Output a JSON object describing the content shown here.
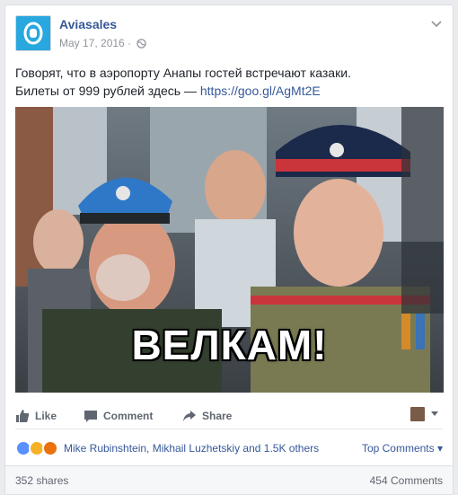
{
  "post": {
    "page_name": "Aviasales",
    "date": "May 17, 2016 ·",
    "text_line1": "Говорят, что в аэропорту Анапы гостей встречают казаки.",
    "text_line2": "Билеты от 999 рублей здесь — ",
    "link": "https://goo.gl/AgMt2E",
    "image_caption": "ВЕЛКАМ!"
  },
  "actions": {
    "like": "Like",
    "comment": "Comment",
    "share": "Share"
  },
  "reactions": {
    "names": "Mike Rubinshtein, Mikhail Luzhetskiy and 1.5K others",
    "top_comments": "Top Comments ▾",
    "icons": [
      "like-reaction-icon",
      "haha-reaction-icon",
      "angry-reaction-icon"
    ]
  },
  "counts": {
    "shares": "352 shares",
    "comments": "454 Comments"
  },
  "colors": {
    "link": "#365899",
    "brand": "#29a7df",
    "muted": "#90949c"
  }
}
